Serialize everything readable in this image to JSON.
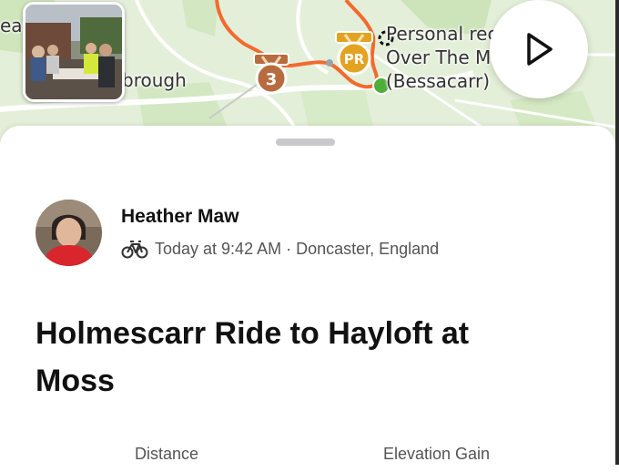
{
  "map": {
    "labels": {
      "west": "ear",
      "town": "brough",
      "poi_line1": "Personal rec",
      "poi_line2": "Over The M",
      "poi_line3": "(Bessacarr)"
    },
    "badges": {
      "rank_badge_text": "3",
      "pr_badge_text": "PR"
    },
    "route_color": "#f26a2e",
    "end_marker_color": "#4fae3a"
  },
  "activity": {
    "athlete_name": "Heather Maw",
    "sport_icon": "bike-icon",
    "time_location": "Today at 9:42 AM · Doncaster, England",
    "title": "Holmescarr Ride to Hayloft at Moss"
  },
  "stats": {
    "distance_label": "Distance",
    "elevation_label": "Elevation Gain"
  }
}
